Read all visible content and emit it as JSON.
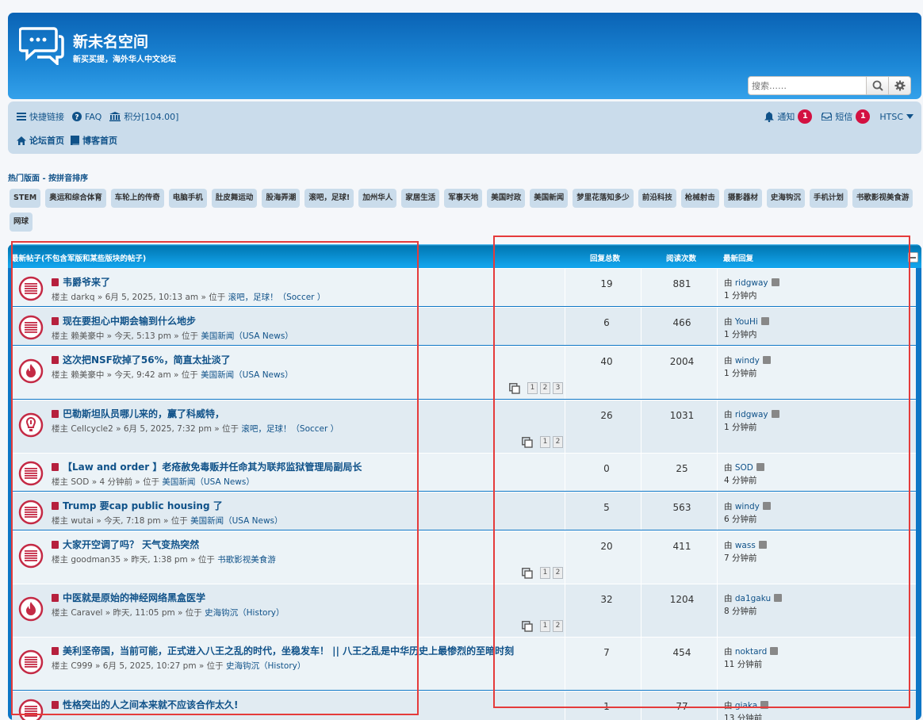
{
  "header": {
    "site_title": "新未名空间",
    "site_desc": "新买买提，海外华人中文论坛",
    "search_placeholder": "搜索……"
  },
  "nav": {
    "quick_links": "快捷链接",
    "faq": "FAQ",
    "points": "积分[104.00]",
    "forum_home": "论坛首页",
    "blog_home": "博客首页",
    "notifications": "通知",
    "notifications_count": "1",
    "messages": "短信",
    "messages_count": "1",
    "user": "HTSC"
  },
  "hot": {
    "title": "热门版面 - 按拼音排序",
    "tags": [
      "STEM",
      "奥运和综合体育",
      "车轮上的传奇",
      "电脑手机",
      "肚皮舞运动",
      "股海弄潮",
      "滚吧，足球!",
      "加州华人",
      "家居生活",
      "军事天地",
      "美国时政",
      "美国新闻",
      "梦里花落知多少",
      "前沿科技",
      "枪械射击",
      "摄影器材",
      "史海钩沉",
      "手机计划",
      "书歌影视美食游",
      "网球"
    ]
  },
  "topics": {
    "header": {
      "title": "最新帖子(不包含军版和某些版块的帖子)",
      "replies": "回复总数",
      "views": "阅读次数",
      "last": "最新回复"
    },
    "rows": [
      {
        "title": "韦爵爷来了",
        "meta_pre": "楼主 darkq » 6月 5, 2025, 10:13 am » 位于 ",
        "forum": "滚吧，足球！（Soccer ）",
        "replies": "19",
        "views": "881",
        "last_by": "由 ",
        "last_user": "ridgway",
        "last_time": "1 分钟内",
        "icon": "normal",
        "pages": []
      },
      {
        "title": "现在要担心中期会输到什么地步",
        "meta_pre": "楼主 赖美豪中 » 今天, 5:13 pm » 位于 ",
        "forum": "美国新闻（USA News）",
        "replies": "6",
        "views": "466",
        "last_by": "由 ",
        "last_user": "YouHi",
        "last_time": "1 分钟内",
        "icon": "normal",
        "pages": []
      },
      {
        "title": "这次把NSF砍掉了56%，简直太扯淡了",
        "meta_pre": "楼主 赖美豪中 » 今天, 9:42 am » 位于 ",
        "forum": "美国新闻（USA News）",
        "replies": "40",
        "views": "2004",
        "last_by": "由 ",
        "last_user": "windy",
        "last_time": "1 分钟前",
        "icon": "hot",
        "pages": [
          "1",
          "2",
          "3"
        ]
      },
      {
        "title": "巴勒斯坦队员哪儿来的，赢了科威特，",
        "meta_pre": "楼主 Cellcycle2 » 6月 5, 2025, 7:32 pm » 位于 ",
        "forum": "滚吧，足球！（Soccer ）",
        "replies": "26",
        "views": "1031",
        "last_by": "由 ",
        "last_user": "ridgway",
        "last_time": "1 分钟前",
        "icon": "alert",
        "pages": [
          "1",
          "2"
        ]
      },
      {
        "title": "【Law and order 】老疮赦免毒贩并任命其为联邦监狱管理局副局长",
        "meta_pre": "楼主 SOD » 4 分钟前 » 位于 ",
        "forum": "美国新闻（USA News）",
        "replies": "0",
        "views": "25",
        "last_by": "由 ",
        "last_user": "SOD",
        "last_time": "4 分钟前",
        "icon": "normal",
        "pages": []
      },
      {
        "title": "Trump 要cap public housing 了",
        "meta_pre": "楼主 wutai » 今天, 7:18 pm » 位于 ",
        "forum": "美国新闻（USA News）",
        "replies": "5",
        "views": "563",
        "last_by": "由 ",
        "last_user": "windy",
        "last_time": "6 分钟前",
        "icon": "normal",
        "pages": []
      },
      {
        "title": "大家开空调了吗？ 天气变热突然",
        "meta_pre": "楼主 goodman35 » 昨天, 1:38 pm » 位于 ",
        "forum": "书歌影视美食游",
        "replies": "20",
        "views": "411",
        "last_by": "由 ",
        "last_user": "wass",
        "last_time": "7 分钟前",
        "icon": "normal",
        "pages": [
          "1",
          "2"
        ]
      },
      {
        "title": "中医就是原始的神经网络黑盒医学",
        "meta_pre": "楼主 Caravel » 昨天, 11:05 pm » 位于 ",
        "forum": "史海钩沉（History）",
        "replies": "32",
        "views": "1204",
        "last_by": "由 ",
        "last_user": "da1gaku",
        "last_time": "8 分钟前",
        "icon": "hot",
        "pages": [
          "1",
          "2"
        ]
      },
      {
        "title": "美利坚帝国，当前可能，正式进入八王之乱的时代，坐稳发车！ || 八王之乱是中华历史上最惨烈的至暗时刻",
        "meta_pre": "楼主 C999 » 6月 5, 2025, 10:27 pm » 位于 ",
        "forum": "史海钩沉（History）",
        "replies": "7",
        "views": "454",
        "last_by": "由 ",
        "last_user": "noktard",
        "last_time": "11 分钟前",
        "icon": "normal",
        "pages": []
      },
      {
        "title": "性格突出的人之间本来就不应该合作太久!",
        "meta_pre": "",
        "forum": "",
        "replies": "1",
        "views": "77",
        "last_by": "由 ",
        "last_user": "giaka",
        "last_time": "13 分钟前",
        "icon": "normal",
        "pages": []
      }
    ]
  },
  "colors": {
    "header_dark": "#0a63b5",
    "header_light": "#34a1ea",
    "link": "#105289",
    "badge": "#d31141",
    "highlight_box": "#e53b3b"
  }
}
